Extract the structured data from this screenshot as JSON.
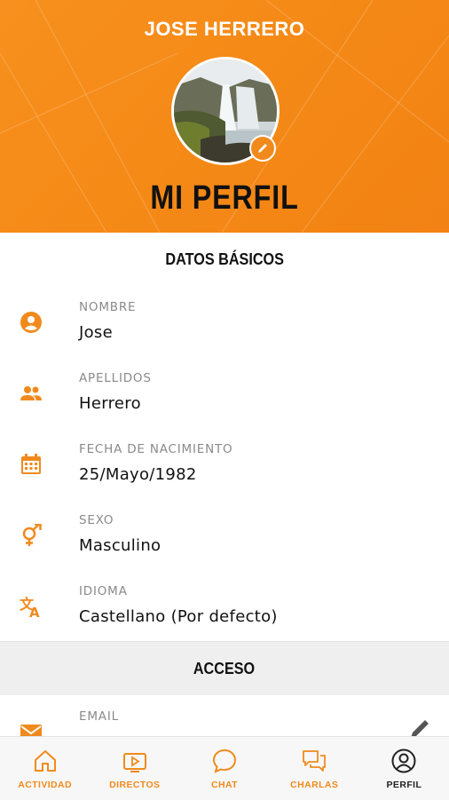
{
  "profile": {
    "user_name": "JOSE HERRERO",
    "page_title": "MI PERFIL"
  },
  "sections": {
    "basic": "DATOS BÁSICOS",
    "access": "ACCESO"
  },
  "fields": [
    {
      "label": "NOMBRE",
      "value": "Jose",
      "icon": "person-circle-icon"
    },
    {
      "label": "APELLIDOS",
      "value": "Herrero",
      "icon": "people-icon"
    },
    {
      "label": "FECHA DE NACIMIENTO",
      "value": "25/Mayo/1982",
      "icon": "calendar-icon"
    },
    {
      "label": "SEXO",
      "value": "Masculino",
      "icon": "gender-icon"
    },
    {
      "label": "IDIOMA",
      "value": "Castellano (Por defecto)",
      "icon": "translate-icon"
    }
  ],
  "access_fields": [
    {
      "label": "EMAIL",
      "icon": "mail-icon"
    }
  ],
  "nav": [
    {
      "label": "ACTIVIDAD",
      "icon": "home-icon",
      "active": false
    },
    {
      "label": "DIRECTOS",
      "icon": "live-tv-icon",
      "active": false
    },
    {
      "label": "CHAT",
      "icon": "chat-bubble-icon",
      "active": false
    },
    {
      "label": "CHARLAS",
      "icon": "forum-icon",
      "active": false
    },
    {
      "label": "PERFIL",
      "icon": "profile-icon",
      "active": true
    }
  ],
  "colors": {
    "accent": "#f08a1d",
    "header": "#f58a17",
    "text": "#111111",
    "label": "#8a8a8a",
    "nav_active": "#222222"
  }
}
